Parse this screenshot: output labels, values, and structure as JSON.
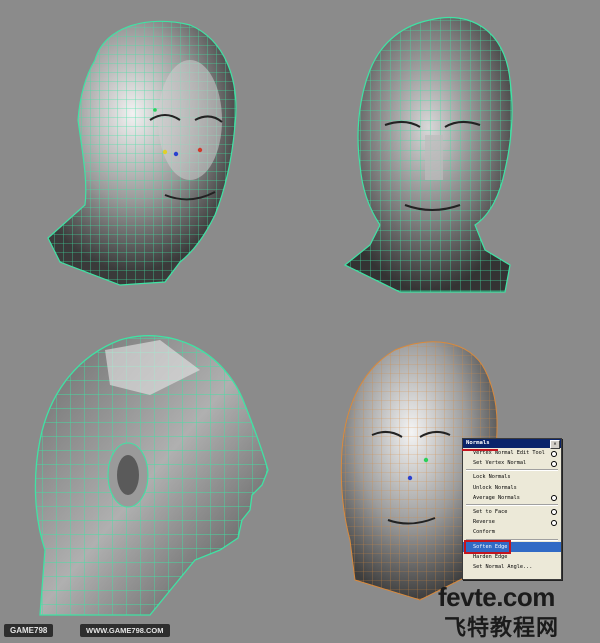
{
  "menu": {
    "title": "Normals",
    "close": "✕",
    "items": [
      {
        "label": "Vertex Normal Edit Tool",
        "option": true
      },
      {
        "label": "Set Vertex Normal",
        "option": true
      },
      {
        "sep": true
      },
      {
        "label": "Lock Normals",
        "option": false
      },
      {
        "label": "Unlock Normals",
        "option": false
      },
      {
        "label": "Average Normals",
        "option": true
      },
      {
        "sep": true
      },
      {
        "label": "Set to Face",
        "option": true
      },
      {
        "label": "Reverse",
        "option": true
      },
      {
        "label": "Conform",
        "option": false
      },
      {
        "sep": true
      },
      {
        "label": "Soften Edge",
        "option": false,
        "selected": true
      },
      {
        "label": "Harden Edge",
        "option": false
      },
      {
        "label": "Set Normal Angle...",
        "option": false
      }
    ]
  },
  "footer": {
    "badge": "GAME798",
    "site": "WWW.GAME798.COM"
  },
  "watermark": {
    "latin": "fevte.com",
    "chinese": "飞特教程网"
  },
  "colors": {
    "viewport_bg": "#8b8b8b",
    "wire_green": "#3fe3a4",
    "wire_orange": "#d98a3c",
    "menu_highlight": "#316ac5",
    "callout_red": "#c4141e"
  }
}
